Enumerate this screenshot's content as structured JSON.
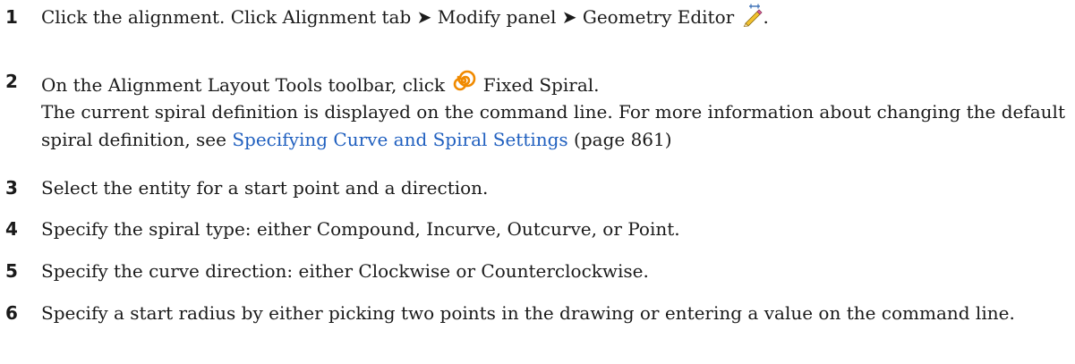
{
  "steps": [
    {
      "number": "1",
      "text_a": "Click the alignment. Click Alignment tab ",
      "arrow1": "➤",
      "text_b": " Modify panel ",
      "arrow2": "➤",
      "text_c": " Geometry Editor ",
      "icon": "geometry-editor-pencil-icon",
      "text_d": "."
    },
    {
      "number": "2",
      "text_a": "On the Alignment Layout Tools toolbar, click ",
      "icon": "fixed-spiral-icon",
      "text_b": " Fixed Spiral.",
      "note_a": "The current spiral definition is displayed on the command line. For more information about changing the default spiral definition, see ",
      "link": "Specifying Curve and Spiral Settings",
      "note_b": " (page 861)"
    },
    {
      "number": "3",
      "text": "Select the entity for a start point and a direction."
    },
    {
      "number": "4",
      "text": "Specify the spiral type: either Compound, Incurve, Outcurve, or Point."
    },
    {
      "number": "5",
      "text": "Specify the curve direction: either Clockwise or Counterclockwise."
    },
    {
      "number": "6",
      "text": "Specify a start radius by either picking two points in the drawing or entering a value on the command line."
    }
  ],
  "colors": {
    "text": "#1a1a1a",
    "link": "#1f5fbf",
    "spiral_icon": "#f08a00"
  }
}
